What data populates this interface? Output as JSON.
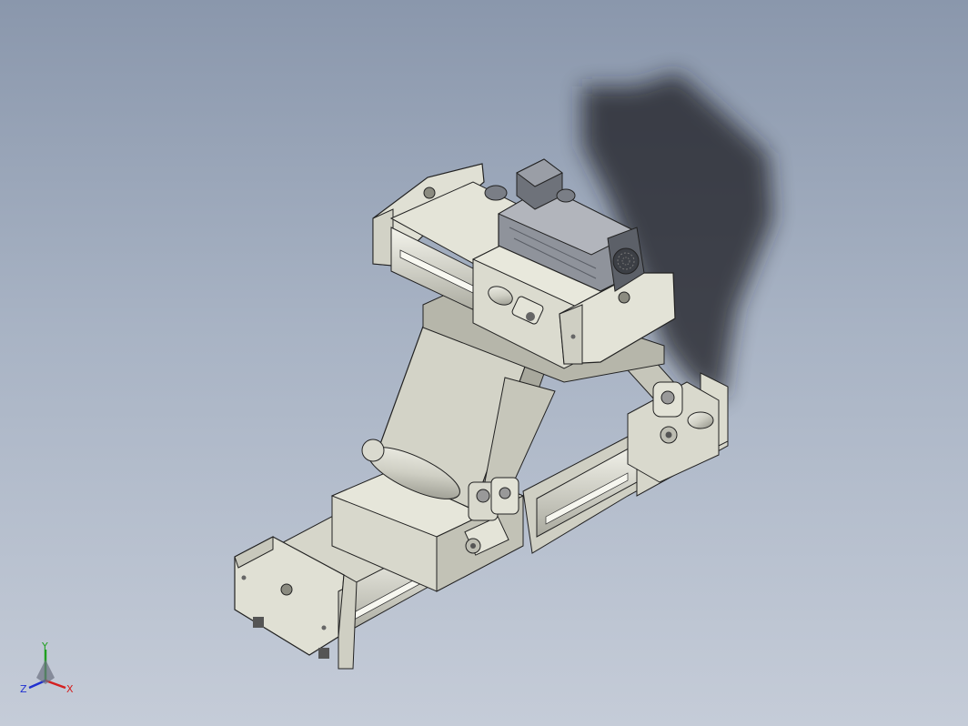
{
  "viewport": {
    "background_top": "#8a97ac",
    "background_bottom": "#c5ccd8",
    "part_color": "#d9d9cc",
    "part_shade": "#b9b9ad",
    "motor_color": "#9a9ea6"
  },
  "triad": {
    "x_label": "X",
    "y_label": "Y",
    "z_label": "Z",
    "x_color": "#d42020",
    "y_color": "#20a020",
    "z_color": "#2030d0"
  }
}
